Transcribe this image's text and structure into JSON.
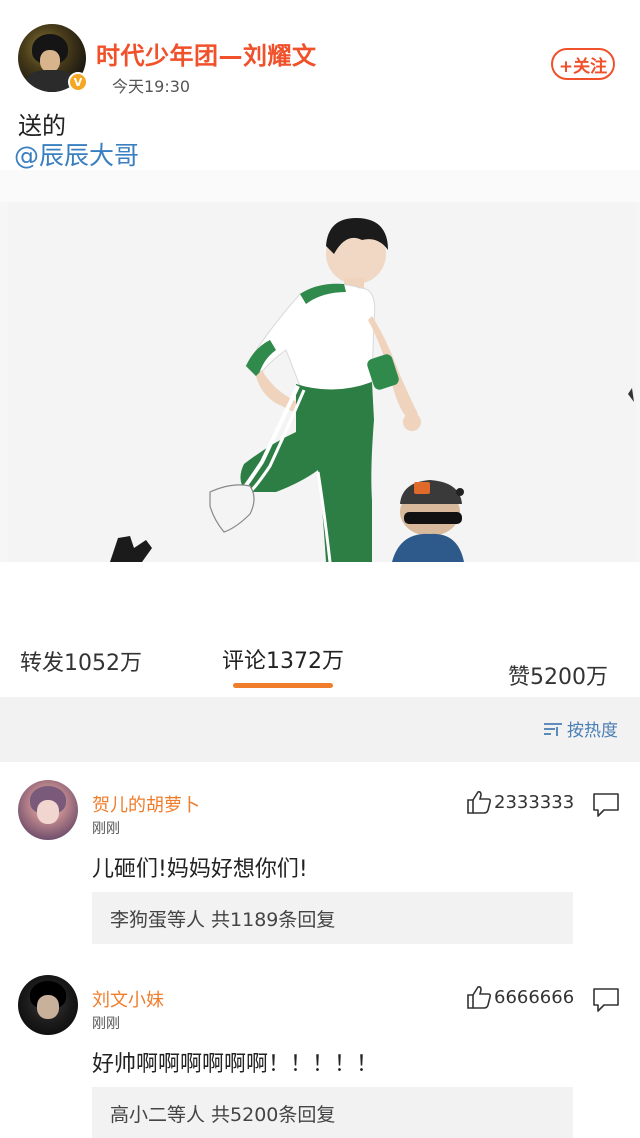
{
  "post": {
    "author": "时代少年团—刘耀文",
    "verified_mark": "V",
    "time": "今天19:30",
    "follow_label": "+关注",
    "text": "送的",
    "mention": "@辰辰大哥",
    "media": "photo"
  },
  "tabs": {
    "repost": "转发1052万",
    "comments": "评论1372万",
    "likes": "赞5200万",
    "active": "comments"
  },
  "sort": {
    "label": "按热度",
    "icon": "sort-icon"
  },
  "comments": [
    {
      "name": "贺儿的胡萝卜",
      "time": "刚刚",
      "likes": "2333333",
      "text": "儿砸们!妈妈好想你们!",
      "replies": "李狗蛋等人 共1189条回复"
    },
    {
      "name": "刘文小妹",
      "time": "刚刚",
      "likes": "6666666",
      "text": "好帅啊啊啊啊啊啊！！！！！",
      "replies": "高小二等人 共5200条回复"
    }
  ],
  "colors": {
    "accent": "#f0502a",
    "comment_name": "#f07d2b",
    "link": "#3a7fc0",
    "sort": "#4a7eb5"
  }
}
